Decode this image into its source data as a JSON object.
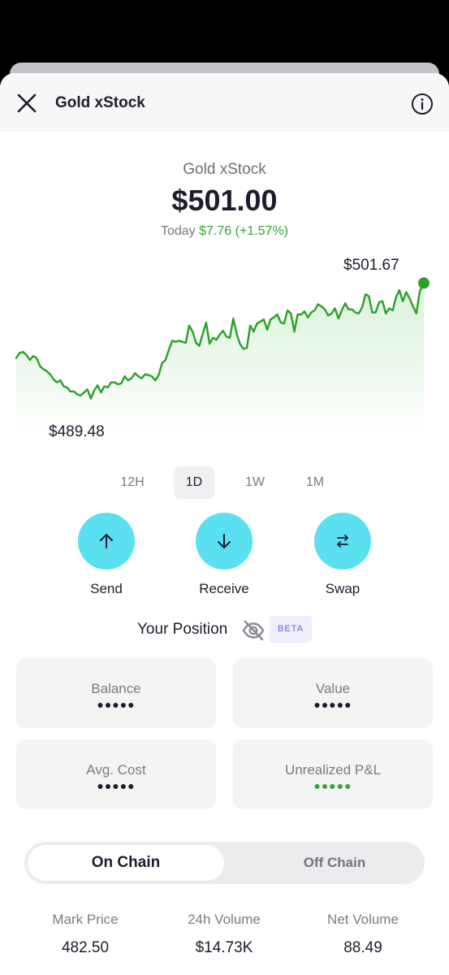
{
  "header": {
    "title": "Gold xStock",
    "close_icon": "close-icon",
    "info_icon": "info-icon"
  },
  "asset": {
    "name": "Gold xStock",
    "price": "$501.00",
    "today_label": "Today",
    "today_change": "$7.76 (+1.57%)",
    "change_color": "#36a436"
  },
  "chart_data": {
    "type": "area",
    "high_label": "$501.67",
    "low_label": "$489.48",
    "ylim": [
      489.48,
      501.67
    ],
    "line_color": "#2aa02a",
    "values": [
      493.6,
      494.1,
      494.2,
      493.9,
      493.4,
      493.8,
      493.6,
      492.8,
      492.5,
      492.3,
      492,
      491.5,
      491.2,
      491.4,
      490.8,
      490.7,
      490.3,
      490.3,
      490.0,
      489.9,
      490.2,
      490.5,
      489.6,
      490.4,
      490.9,
      490.2,
      490.8,
      490.7,
      491.2,
      491.2,
      491.0,
      491.1,
      491.8,
      491.4,
      491.6,
      492.1,
      491.8,
      491.6,
      492.0,
      491.9,
      491.8,
      491.4,
      491.9,
      493.1,
      493.4,
      494.4,
      495.3,
      495.2,
      495.3,
      495.2,
      495.1,
      496.8,
      496.2,
      495.1,
      494.8,
      496.0,
      497.1,
      495.0,
      495.6,
      495.4,
      495.9,
      496.3,
      495.7,
      495.6,
      497.5,
      496.0,
      495.0,
      494.5,
      494.6,
      496.8,
      496.2,
      497.0,
      497.2,
      497.4,
      496.4,
      497.4,
      497.6,
      497.9,
      497.1,
      497.0,
      498.3,
      498.0,
      496.2,
      497.9,
      497.9,
      498.2,
      497.6,
      498.1,
      498.3,
      498.9,
      498.7,
      498.4,
      497.8,
      498.0,
      498.5,
      497.5,
      498.3,
      499.0,
      498.4,
      498.4,
      498.1,
      498.0,
      498.6,
      499.9,
      499.7,
      498.1,
      498.1,
      499.1,
      499.2,
      498.0,
      498.5,
      498.3,
      499.6,
      500.3,
      499.2,
      500.1,
      499.5,
      498.7,
      498.0,
      500.2
    ],
    "end_point": 501.0
  },
  "ranges": {
    "items": [
      "12H",
      "1D",
      "1W",
      "1M"
    ],
    "selected": "1D"
  },
  "actions": {
    "send": {
      "label": "Send",
      "icon": "arrow-up-icon"
    },
    "receive": {
      "label": "Receive",
      "icon": "arrow-down-icon"
    },
    "swap": {
      "label": "Swap",
      "icon": "swap-icon"
    },
    "accent": "#5ae0f0"
  },
  "position": {
    "title": "Your Position",
    "eye_icon": "eye-off-icon",
    "badge": "BETA",
    "cards": {
      "balance": {
        "label": "Balance",
        "value": "●●●●●"
      },
      "value": {
        "label": "Value",
        "value": "●●●●●"
      },
      "avg_cost": {
        "label": "Avg. Cost",
        "value": "●●●●●"
      },
      "pnl": {
        "label": "Unrealized P&L",
        "value": "●●●●●"
      }
    }
  },
  "chain_toggle": {
    "on": "On Chain",
    "off": "Off Chain",
    "selected": "On Chain"
  },
  "stats": {
    "mark_price": {
      "label": "Mark Price",
      "value": "482.50"
    },
    "volume_24h": {
      "label": "24h Volume",
      "value": "$14.73K"
    },
    "net_volume": {
      "label": "Net Volume",
      "value": "88.49"
    }
  }
}
